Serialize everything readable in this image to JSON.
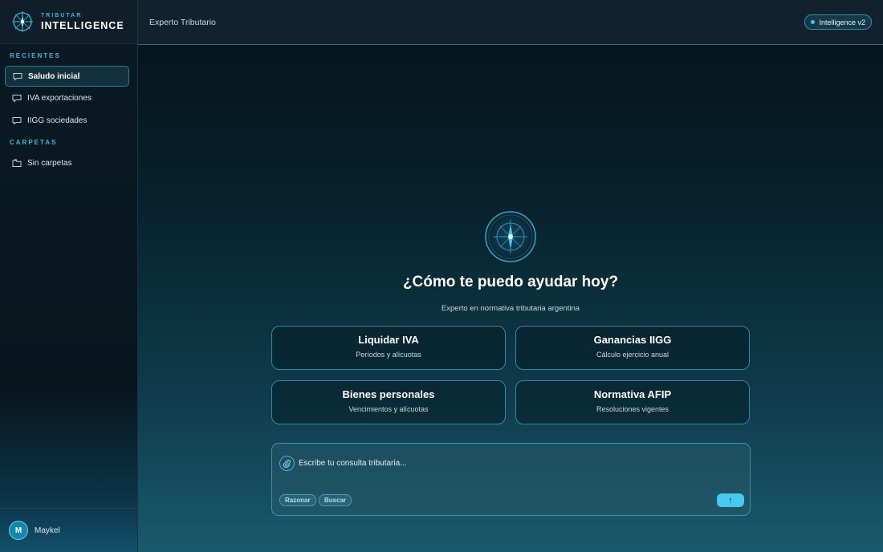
{
  "brand": {
    "small": "TRIBUTAR",
    "big": "INTELLIGENCE"
  },
  "sidebar": {
    "recent_title": "RECIENTES",
    "recent_items": [
      {
        "label": "Saludo inicial",
        "icon": "chat-bubble-icon",
        "active": true
      },
      {
        "label": "IVA exportaciones",
        "icon": "chat-bubble-icon",
        "active": false
      },
      {
        "label": "IIGG sociedades",
        "icon": "chat-bubble-icon",
        "active": false
      }
    ],
    "folders_title": "CARPETAS",
    "folder_items": [
      {
        "label": "Sin carpetas",
        "icon": "folder-icon"
      }
    ]
  },
  "user": {
    "initial": "M",
    "name": "Maykel"
  },
  "header": {
    "title": "Experto Tributario",
    "version": "Intelligence v2"
  },
  "hero": {
    "title": "¿Cómo te puedo ayudar hoy?",
    "subtitle": "Experto en normativa tributaria argentina"
  },
  "cards": [
    {
      "title": "Liquidar IVA",
      "subtitle": "Períodos y alícuotas"
    },
    {
      "title": "Ganancias IIGG",
      "subtitle": "Cálculo ejercicio anual"
    },
    {
      "title": "Bienes personales",
      "subtitle": "Vencimientos y alícuotas"
    },
    {
      "title": "Normativa AFIP",
      "subtitle": "Resoluciones vigentes"
    }
  ],
  "composer": {
    "placeholder": "Escribe tu consulta tributaria...",
    "chip_reason": "Razonar",
    "chip_search": "Buscar",
    "send_icon": "↑"
  },
  "colors": {
    "accent": "#45c9ee",
    "brand_small": "#3fb8d8",
    "card_border": "#2f8aa6"
  }
}
